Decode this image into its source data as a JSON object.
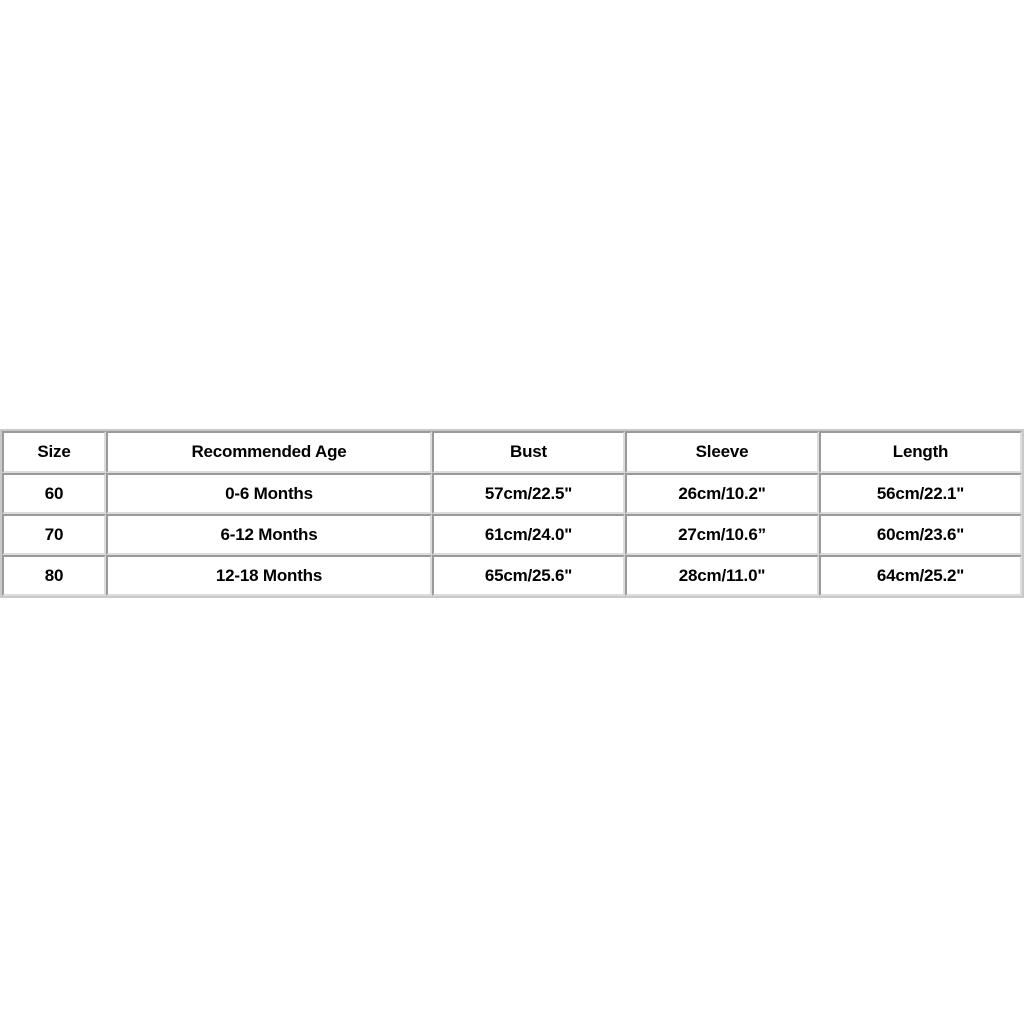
{
  "table": {
    "name": "baby-clothing-size-chart",
    "columns": [
      {
        "key": "size",
        "label": "Size"
      },
      {
        "key": "age",
        "label": "Recommended Age"
      },
      {
        "key": "bust",
        "label": "Bust"
      },
      {
        "key": "sleeve",
        "label": "Sleeve"
      },
      {
        "key": "length",
        "label": "Length"
      }
    ],
    "rows": [
      {
        "size": "60",
        "age": "0-6 Months",
        "bust": "57cm/22.5\"",
        "sleeve": "26cm/10.2\"",
        "length": "56cm/22.1\""
      },
      {
        "size": "70",
        "age": "6-12 Months",
        "bust": "61cm/24.0\"",
        "sleeve": "27cm/10.6”",
        "length": "60cm/23.6\""
      },
      {
        "size": "80",
        "age": "12-18 Months",
        "bust": "65cm/25.6\"",
        "sleeve": "28cm/11.0\"",
        "length": "64cm/25.2\""
      }
    ]
  },
  "colors": {
    "page_background": "#ffffff",
    "cell_background": "#ffffff",
    "text": "#000000",
    "border_light": "#dcdcdc",
    "border_dark": "#9a9a9a",
    "table_outer_border": "#c9c9c9"
  }
}
